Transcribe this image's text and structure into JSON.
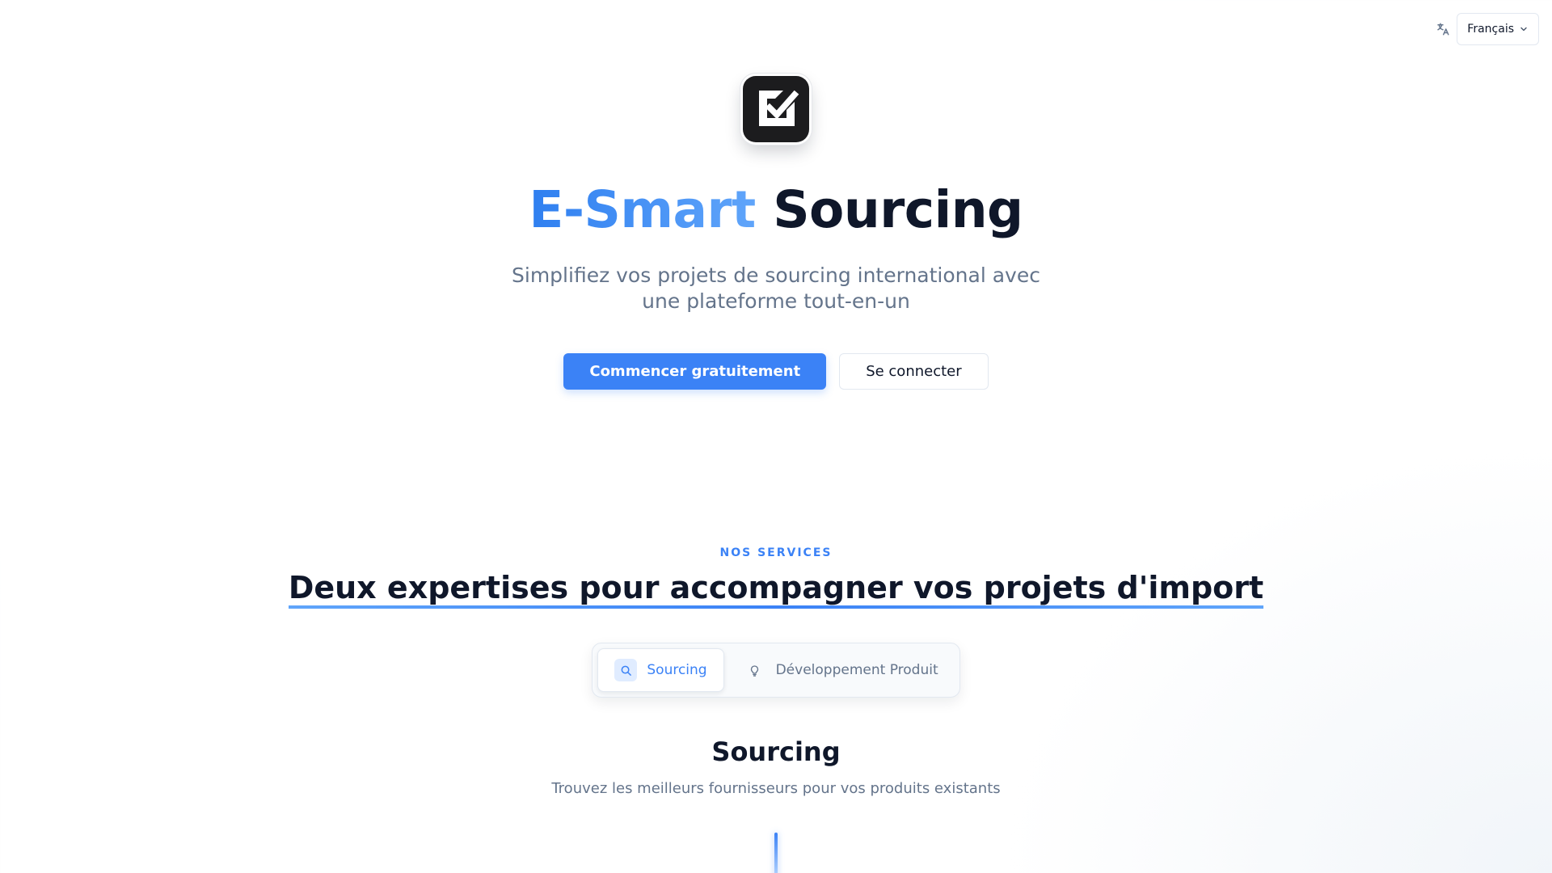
{
  "language": {
    "icon": "translate-icon",
    "selected": "Français",
    "chevron": "chevron-down-icon"
  },
  "hero": {
    "logo_icon": "checkbox-logo-icon",
    "title_accent": "E-Smart",
    "title_main": "Sourcing",
    "subtitle": "Simplifiez vos projets de sourcing international avec une plateforme tout-en-un",
    "primary_cta": "Commencer gratuitement",
    "secondary_cta": "Se connecter"
  },
  "services": {
    "eyebrow": "NOS SERVICES",
    "title": "Deux expertises pour accompagner vos projets d'import",
    "tabs": [
      {
        "label": "Sourcing",
        "icon": "search-icon",
        "active": true
      },
      {
        "label": "Développement Produit",
        "icon": "lightbulb-icon",
        "active": false
      }
    ],
    "active_section": {
      "title": "Sourcing",
      "description": "Trouvez les meilleurs fournisseurs pour vos produits existants"
    }
  },
  "colors": {
    "accent": "#3b82f6",
    "text_dark": "#0f172a",
    "text_muted": "#64748b",
    "logo_bg": "#1c1c1e"
  }
}
